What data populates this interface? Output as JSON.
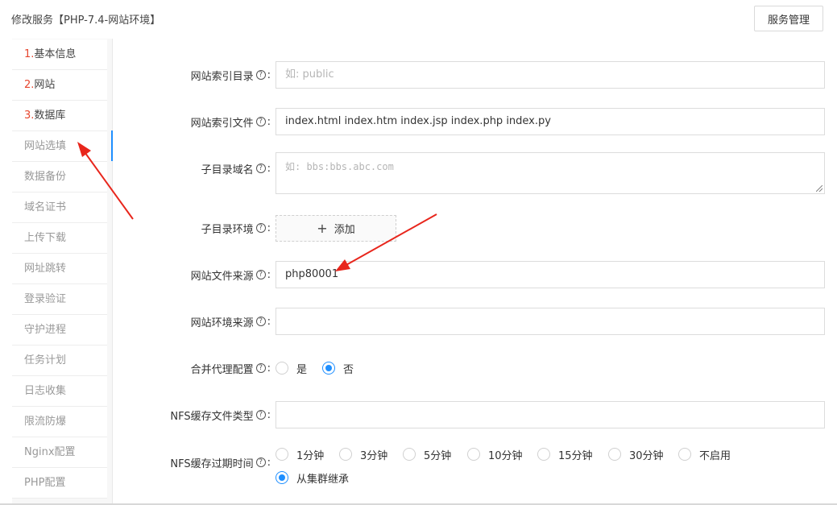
{
  "header": {
    "title": "修改服务【PHP-7.4-网站环境】",
    "manage_button": "服务管理"
  },
  "sidebar": {
    "items": [
      {
        "num": "1.",
        "label": "基本信息"
      },
      {
        "num": "2.",
        "label": "网站"
      },
      {
        "num": "3.",
        "label": "数据库"
      },
      {
        "num": "",
        "label": "网站选填"
      },
      {
        "num": "",
        "label": "数据备份"
      },
      {
        "num": "",
        "label": "域名证书"
      },
      {
        "num": "",
        "label": "上传下载"
      },
      {
        "num": "",
        "label": "网址跳转"
      },
      {
        "num": "",
        "label": "登录验证"
      },
      {
        "num": "",
        "label": "守护进程"
      },
      {
        "num": "",
        "label": "任务计划"
      },
      {
        "num": "",
        "label": "日志收集"
      },
      {
        "num": "",
        "label": "限流防爆"
      },
      {
        "num": "",
        "label": "Nginx配置"
      },
      {
        "num": "",
        "label": "PHP配置"
      }
    ],
    "active_index": 3
  },
  "form": {
    "help_glyph": "?",
    "colon": ":",
    "index_dir": {
      "label": "网站索引目录",
      "value": "",
      "placeholder": "如: public"
    },
    "index_file": {
      "label": "网站索引文件",
      "value": "index.html index.htm index.jsp index.php index.py"
    },
    "subdir_domain": {
      "label": "子目录域名",
      "placeholder": "如: bbs:bbs.abc.com"
    },
    "subdir_env": {
      "label": "子目录环境",
      "add_label": "添加",
      "add_glyph": "+"
    },
    "file_source": {
      "label": "网站文件来源",
      "value": "php80001"
    },
    "env_source": {
      "label": "网站环境来源",
      "value": ""
    },
    "merge_proxy": {
      "label": "合并代理配置",
      "options": [
        "是",
        "否"
      ],
      "selected": "否"
    },
    "nfs_types": {
      "label": "NFS缓存文件类型",
      "value": ""
    },
    "nfs_expire": {
      "label": "NFS缓存过期时间",
      "options": [
        "1分钟",
        "3分钟",
        "5分钟",
        "10分钟",
        "15分钟",
        "30分钟",
        "不启用",
        "从集群继承"
      ],
      "selected": "从集群继承"
    }
  },
  "colors": {
    "accent": "#1f8fff",
    "annotation_arrow": "#e8261c",
    "number_red": "#e6452d"
  }
}
